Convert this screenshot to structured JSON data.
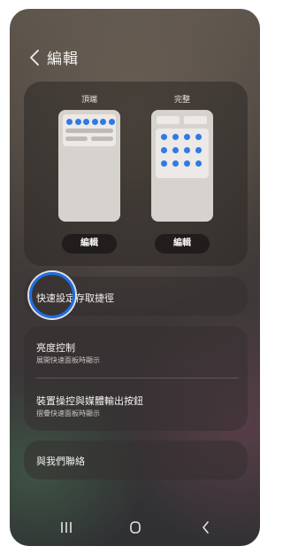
{
  "header": {
    "title": "編輯"
  },
  "preview": {
    "left_label": "頂端",
    "right_label": "完整",
    "left_edit": "編輯",
    "right_edit": "編輯"
  },
  "settings": {
    "shortcut_title": "快速設定存取捷徑",
    "brightness_title": "亮度控制",
    "brightness_sub": "展開快速面板時顯示",
    "device_title": "裝置操控與媒體輸出按鈕",
    "device_sub": "摺疊快速面板時顯示",
    "contact_title": "與我們聯絡"
  },
  "colors": {
    "accent": "#2f7ae5",
    "ring": "#1f6fe5"
  },
  "icons": {
    "back": "chevron-left-icon",
    "recents": "recents-icon",
    "home": "home-icon",
    "nav_back": "nav-back-icon"
  }
}
